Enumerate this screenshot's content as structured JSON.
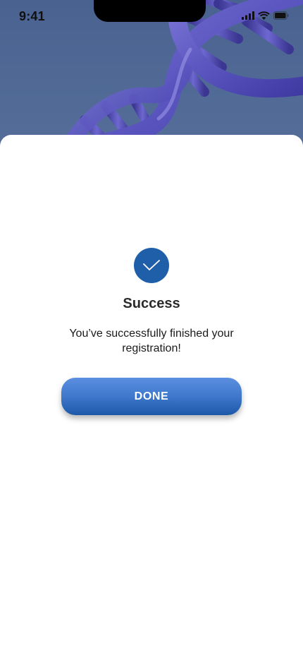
{
  "status_bar": {
    "time": "9:41"
  },
  "hero": {
    "image": "dna-helix-icon"
  },
  "dialog": {
    "icon": "check-icon",
    "title": "Success",
    "message": "You’ve successfully finished your registration!",
    "done_label": "DONE"
  },
  "colors": {
    "hero_background": "#4d6690",
    "accent": "#1f5ea8",
    "button_top": "#5b8fe0",
    "button_bottom": "#1d58a8",
    "sheet_background": "#ffffff"
  }
}
